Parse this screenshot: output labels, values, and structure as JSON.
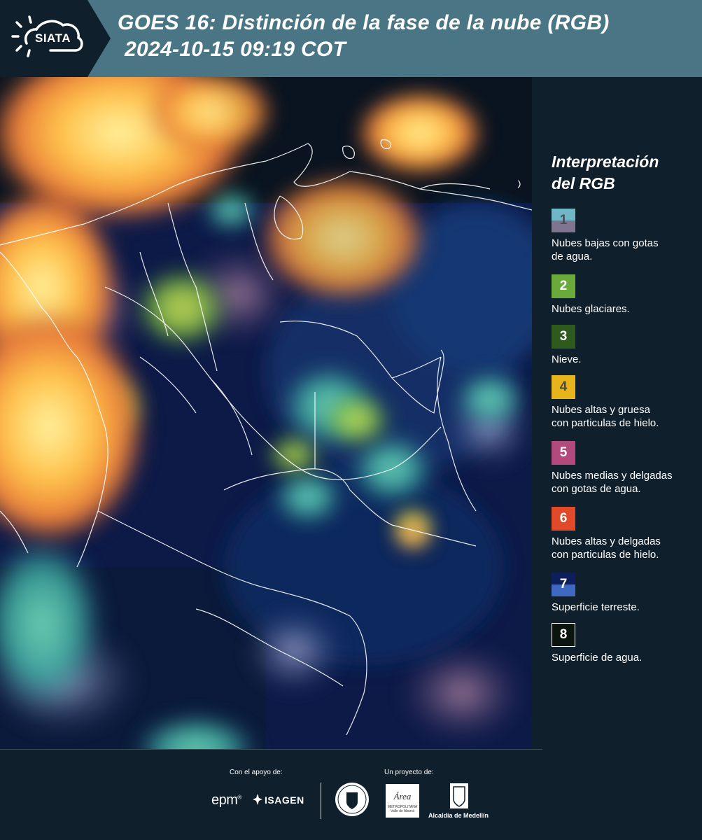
{
  "header": {
    "title_line1": "GOES 16: Distinción de la fase de la nube (RGB)",
    "title_line2": "2024-10-15 09:19 COT",
    "logo_text": "SIATA",
    "logo_icon": "sun-cloud-icon"
  },
  "legend": {
    "title_line1": "Interpretación",
    "title_line2": "del RGB",
    "items": [
      {
        "num": "1",
        "label_line1": "Nubes bajas con gotas",
        "label_line2": "de agua.",
        "color_top": "#6fb6c6",
        "color_bottom": "#7f7590",
        "num_color": "#4a4a5a"
      },
      {
        "num": "2",
        "label_line1": "Nubes glaciares.",
        "label_line2": "",
        "color_top": "#6aaa3a",
        "color_bottom": "#6aaa3a",
        "num_color": "#ffffff"
      },
      {
        "num": "3",
        "label_line1": "Nieve.",
        "label_line2": "",
        "color_top": "#2e5a1e",
        "color_bottom": "#2e5a1e",
        "num_color": "#ffffff"
      },
      {
        "num": "4",
        "label_line1": "Nubes altas y gruesa",
        "label_line2": "con particulas de hielo.",
        "color_top": "#e8b41c",
        "color_bottom": "#e8b41c",
        "num_color": "#4a4a3a"
      },
      {
        "num": "5",
        "label_line1": "Nubes medias y delgadas",
        "label_line2": "con gotas de agua.",
        "color_top": "#b24a7e",
        "color_bottom": "#b24a7e",
        "num_color": "#ffffff"
      },
      {
        "num": "6",
        "label_line1": "Nubes altas y delgadas",
        "label_line2": "con particulas de hielo.",
        "color_top": "#e04a28",
        "color_bottom": "#e04a28",
        "num_color": "#ffffff"
      },
      {
        "num": "7",
        "label_line1": "Superficie terreste.",
        "label_line2": "",
        "color_top": "#0d1e5a",
        "color_bottom": "#3d6ac0",
        "num_color": "#ffffff"
      },
      {
        "num": "8",
        "label_line1": "Superficie de agua.",
        "label_line2": "",
        "color_top": "#0a1510",
        "color_bottom": "#0a1510",
        "num_color": "#ffffff"
      }
    ]
  },
  "footer": {
    "support_label": "Con el apoyo de:",
    "project_label": "Un proyecto de:",
    "sponsor1": "epm",
    "sponsor1_mark": "®",
    "sponsor2": "ISAGEN",
    "amva_text": "Área",
    "amva_sub": "METROPOLITANA Valle de Aburrá",
    "alcaldia": "Alcaldía de Medellín"
  },
  "colors": {
    "header_bg": "#4a7585",
    "panel_bg": "#0f1f2b"
  }
}
